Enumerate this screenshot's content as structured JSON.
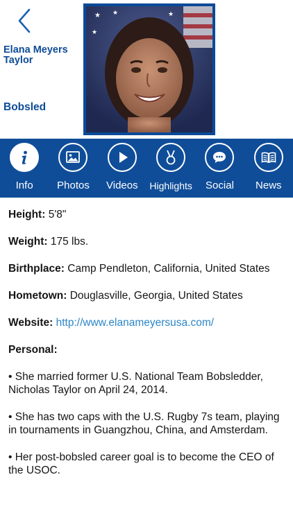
{
  "header": {
    "name": "Elana Meyers Taylor",
    "sport": "Bobsled"
  },
  "tabs": [
    {
      "label": "Info",
      "icon": "info-icon",
      "active": true
    },
    {
      "label": "Photos",
      "icon": "image-icon",
      "active": false
    },
    {
      "label": "Videos",
      "icon": "play-icon",
      "active": false
    },
    {
      "label": "Highlights",
      "icon": "medal-icon",
      "active": false
    },
    {
      "label": "Social",
      "icon": "chat-icon",
      "active": false
    },
    {
      "label": "News",
      "icon": "newspaper-icon",
      "active": false
    }
  ],
  "info": {
    "height_label": "Height:",
    "height_value": "5'8\"",
    "weight_label": "Weight:",
    "weight_value": "175 lbs.",
    "birthplace_label": "Birthplace:",
    "birthplace_value": "Camp Pendleton, California, United States",
    "hometown_label": "Hometown:",
    "hometown_value": "Douglasville, Georgia, United States",
    "website_label": "Website:",
    "website_value": "http://www.elanameyersusa.com/",
    "personal_label": "Personal:",
    "personal_items": [
      "• She married former U.S. National Team Bobsledder, Nicholas Taylor on April 24, 2014.",
      "• She has two caps with the U.S. Rugby 7s team, playing in tournaments in Guangzhou, China, and Amsterdam.",
      "• Her post-bobsled career goal is to become the CEO of the USOC."
    ]
  },
  "colors": {
    "brand_blue": "#0f4d99",
    "name_blue": "#0e4c96",
    "link_blue": "#2b86c9"
  }
}
